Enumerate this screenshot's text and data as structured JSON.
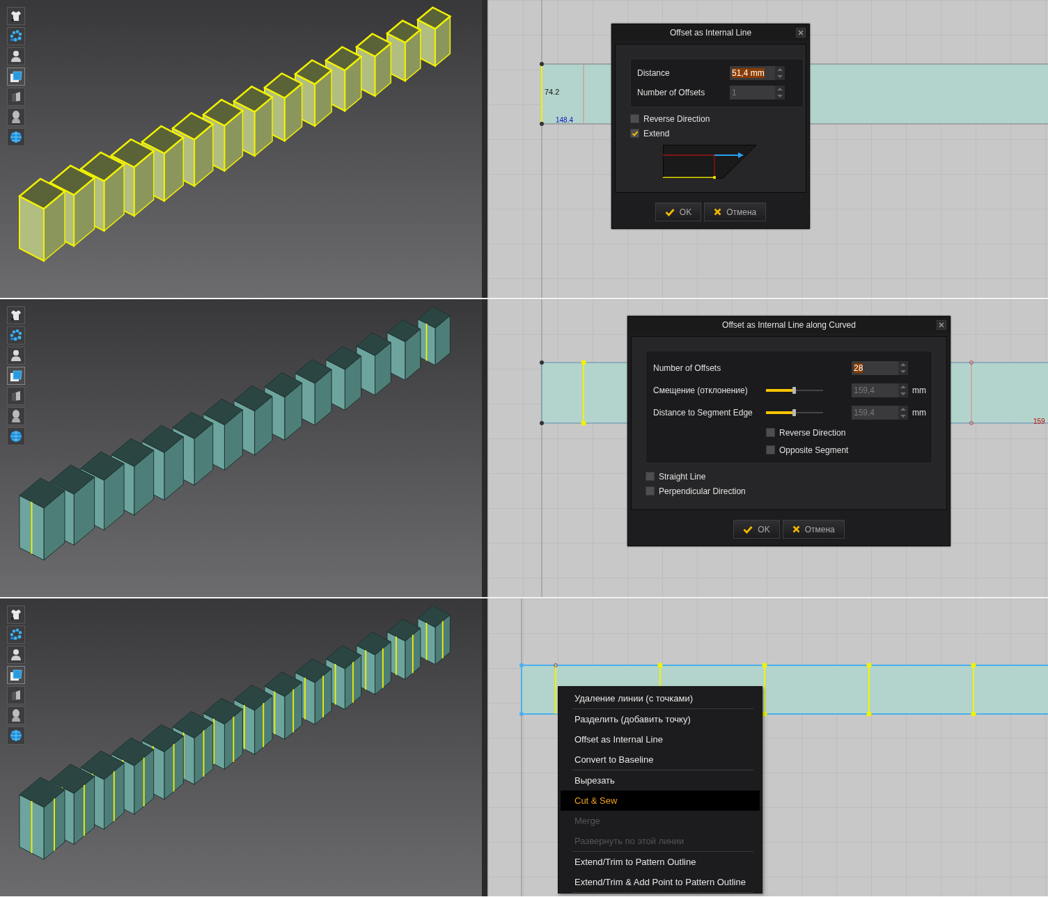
{
  "panels": [
    {
      "model_selected": true,
      "pattern": {
        "labels": [
          {
            "text": "74.2",
            "kind": "length"
          },
          {
            "text": "148.4",
            "kind": "width"
          }
        ]
      },
      "dialog": {
        "kind": "offset",
        "title": "Offset as Internal Line",
        "fields": [
          {
            "kind": "spin",
            "label": "Distance",
            "value": "51,4 mm",
            "highlighted": true,
            "disabled": false
          },
          {
            "kind": "spin",
            "label": "Number of Offsets",
            "value": "1",
            "highlighted": false,
            "disabled": true
          }
        ],
        "checkboxes": [
          {
            "label": "Reverse Direction",
            "checked": false
          },
          {
            "label": "Extend",
            "checked": true
          }
        ],
        "buttons": [
          {
            "kind": "ok",
            "label": "OK"
          },
          {
            "kind": "cancel",
            "label": "Отмена"
          }
        ]
      }
    },
    {
      "model_selected": false,
      "pattern": {
        "labels": [
          {
            "text": "159",
            "kind": "edge"
          }
        ]
      },
      "dialog": {
        "kind": "offset_curved",
        "title": "Offset as Internal Line along Curved",
        "fields": [
          {
            "kind": "spin",
            "label": "Number of Offsets",
            "value": "28",
            "highlighted": true,
            "disabled": false
          },
          {
            "kind": "slider",
            "label": "Смещение (отклонение)",
            "value": "159,4",
            "unit": "mm",
            "level": 0.5,
            "highlighted": false,
            "disabled": true
          },
          {
            "kind": "slider",
            "label": "Distance to Segment Edge",
            "value": "159,4",
            "unit": "mm",
            "level": 0.5,
            "highlighted": false,
            "disabled": true
          }
        ],
        "inner_checkboxes": [
          {
            "label": "Reverse Direction",
            "checked": false
          },
          {
            "label": "Opposite Segment",
            "checked": false
          }
        ],
        "checkboxes": [
          {
            "label": "Straight Line",
            "checked": false
          },
          {
            "label": "Perpendicular Direction",
            "checked": false
          }
        ],
        "buttons": [
          {
            "kind": "ok",
            "label": "OK"
          },
          {
            "kind": "cancel",
            "label": "Отмена"
          }
        ]
      }
    },
    {
      "model_selected": false,
      "context_menu": {
        "items": [
          {
            "label": "Удаление линии (с точками)",
            "selected": false,
            "disabled": false,
            "divider_after": true
          },
          {
            "label": "Разделить (добавить точку)",
            "selected": false,
            "disabled": false,
            "divider_after": false
          },
          {
            "label": "Offset as Internal Line",
            "selected": false,
            "disabled": false,
            "divider_after": false
          },
          {
            "label": "Convert to Baseline",
            "selected": false,
            "disabled": false,
            "divider_after": true
          },
          {
            "label": "Вырезать",
            "selected": false,
            "disabled": false,
            "divider_after": false
          },
          {
            "label": "Cut & Sew",
            "selected": true,
            "disabled": false,
            "divider_after": false
          },
          {
            "label": "Merge",
            "selected": false,
            "disabled": true,
            "divider_after": false
          },
          {
            "label": "Развернуть по этой линии",
            "selected": false,
            "disabled": true,
            "divider_after": true
          },
          {
            "label": "Extend/Trim to Pattern Outline",
            "selected": false,
            "disabled": false,
            "divider_after": false
          },
          {
            "label": "Extend/Trim & Add Point to Pattern Outline",
            "selected": false,
            "disabled": false,
            "divider_after": true
          }
        ]
      }
    }
  ]
}
